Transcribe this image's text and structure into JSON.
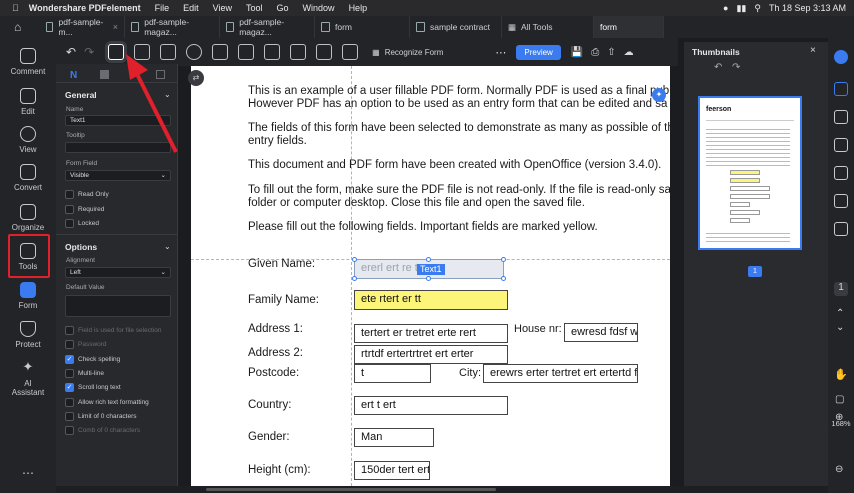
{
  "menubar": {
    "app": "Wondershare PDFelement",
    "items": [
      "File",
      "Edit",
      "View",
      "Tool",
      "Go",
      "Window",
      "Help"
    ],
    "clock": "Th 18 Sep  3:13 AM"
  },
  "tabs": [
    "pdf-sample-m...",
    "pdf-sample-magaz...",
    "pdf-sample-magaz...",
    "form",
    "sample contract",
    "All Tools",
    "form"
  ],
  "rail": [
    {
      "label": "Comment"
    },
    {
      "label": "Edit"
    },
    {
      "label": "View"
    },
    {
      "label": "Convert"
    },
    {
      "label": "Organize"
    },
    {
      "label": "Tools"
    },
    {
      "label": "Form"
    },
    {
      "label": "Protect"
    },
    {
      "label": "AI",
      "label2": "Assistant"
    }
  ],
  "toolbar": {
    "recognize": "Recognize Form",
    "preview": "Preview"
  },
  "panel": {
    "general": "General",
    "name_label": "Name",
    "name_value": "Text1",
    "tooltip_label": "Tooltip",
    "formfield_label": "Form Field",
    "formfield_value": "Visible",
    "checks1": [
      "Read Only",
      "Required",
      "Locked"
    ],
    "options": "Options",
    "alignment_label": "Alignment",
    "alignment_value": "Left",
    "default_label": "Default Value",
    "checks2": [
      {
        "t": "Field is used for file selection",
        "on": false,
        "dim": true
      },
      {
        "t": "Password",
        "on": false,
        "dim": true
      },
      {
        "t": "Check spelling",
        "on": true,
        "dim": false
      },
      {
        "t": "Multi-line",
        "on": false,
        "dim": false
      },
      {
        "t": "Scroll long text",
        "on": true,
        "dim": false
      },
      {
        "t": "Allow rich text formatting",
        "on": false,
        "dim": false
      },
      {
        "t": "Limit of 0 characters",
        "on": false,
        "dim": false
      },
      {
        "t": "Comb of 0 characters",
        "on": false,
        "dim": true
      }
    ]
  },
  "doc": {
    "p1a": "This is an example of a user fillable PDF form. Normally PDF is used as a final publi",
    "p1b": "However PDF has an option to be used as an entry form that can be edited and sa",
    "p2a": "The fields of this form have been selected to demonstrate as many as possible of the c",
    "p2b": "entry fields.",
    "p3": "This document and PDF form have been created with OpenOffice (version 3.4.0).",
    "p4a": "To fill out the form, make sure the PDF file is not read-only. If the file is read-only save i",
    "p4b": "folder or computer desktop. Close this file and open the saved file.",
    "p5": "Please fill out the following fields. Important fields are marked yellow.",
    "given_label": "Given Name:",
    "given_value": "ererl ert re t",
    "field_tag": "Text1",
    "family_label": "Family Name:",
    "family_value": "ete rtert er tt",
    "addr1_label": "Address 1:",
    "addr1_value": "tertert er tretret  erte rert",
    "house_label": "House nr:",
    "house_value": "ewresd fdsf w",
    "addr2_label": "Address 2:",
    "addr2_value": "rtrtdf ertertrtret ert erter",
    "post_label": "Postcode:",
    "post_value": "t",
    "city_label": "City:",
    "city_value": "erewrs erter tertret ert ertertd f",
    "country_label": "Country:",
    "country_value": "ert t ert",
    "gender_label": "Gender:",
    "gender_value": "Man",
    "height_label": "Height (cm):",
    "height_value": "150der tert ertl"
  },
  "thumbs": {
    "title": "Thumbnails",
    "page": "1",
    "thumb_title": "feerson"
  },
  "zoom": "168%"
}
